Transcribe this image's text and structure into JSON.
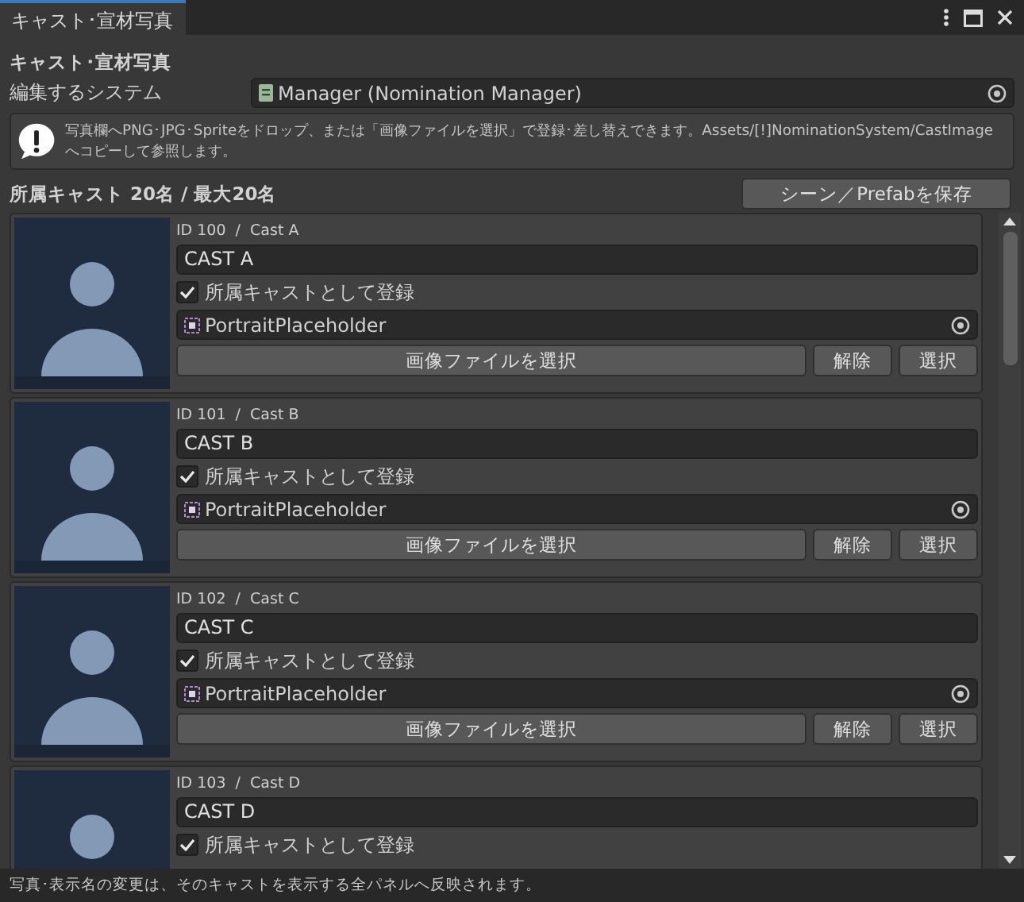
{
  "window": {
    "tab": "キャスト･宣材写真"
  },
  "heading": "キャスト･宣材写真",
  "system_field": {
    "label": "編集するシステム",
    "value": "Manager (Nomination Manager)"
  },
  "help": "写真欄へPNG･JPG･Spriteをドロップ、または「画像ファイルを選択」で登録･差し替えできます。Assets/[!]NominationSystem/CastImageへコピーして参照します。",
  "cast_count": "所属キャスト 20名 / 最大20名",
  "save_button": "シーン／Prefabを保存",
  "casts": [
    {
      "id_label": "ID 100  /  Cast A",
      "name": "CAST A",
      "registered": {
        "label": "所属キャストとして登録",
        "checked": true
      },
      "sprite": "PortraitPlaceholder",
      "buttons": [
        "画像ファイルを選択",
        "解除",
        "選択"
      ]
    },
    {
      "id_label": "ID 101  /  Cast B",
      "name": "CAST B",
      "registered": {
        "label": "所属キャストとして登録",
        "checked": true
      },
      "sprite": "PortraitPlaceholder",
      "buttons": [
        "画像ファイルを選択",
        "解除",
        "選択"
      ]
    },
    {
      "id_label": "ID 102  /  Cast C",
      "name": "CAST C",
      "registered": {
        "label": "所属キャストとして登録",
        "checked": true
      },
      "sprite": "PortraitPlaceholder",
      "buttons": [
        "画像ファイルを選択",
        "解除",
        "選択"
      ]
    },
    {
      "id_label": "ID 103  /  Cast D",
      "name": "CAST D",
      "registered": {
        "label": "所属キャストとして登録",
        "checked": true
      }
    }
  ],
  "status_bar": "写真･表示名の変更は、そのキャストを表示する全パネルへ反映されます。"
}
